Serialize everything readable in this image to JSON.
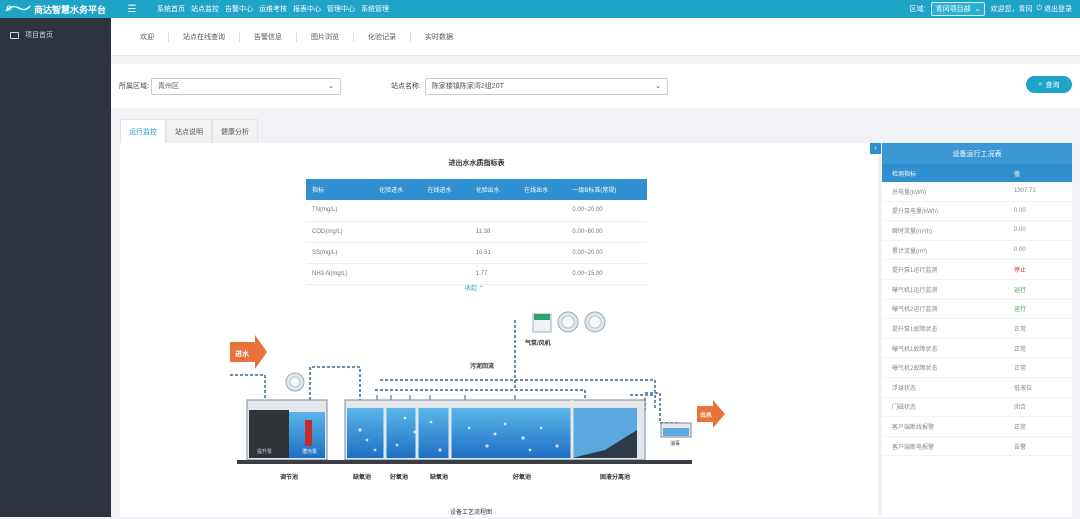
{
  "app": {
    "logo_small": "Shangda",
    "title": "商达智慧水务平台"
  },
  "nav": [
    "系统首页",
    "站点监控",
    "告警中心",
    "运维考核",
    "报表中心",
    "管理中心",
    "系统管理"
  ],
  "header": {
    "region_label": "区域:",
    "region_value": "青冈项目部",
    "welcome": "欢迎您，青冈",
    "logout": "退出登录"
  },
  "sidebar": {
    "items": [
      "项目首页"
    ]
  },
  "subtabs": [
    "欢迎",
    "站点在线查询",
    "告警信息",
    "图片浏览",
    "化验记录",
    "实时数据"
  ],
  "filter": {
    "area_label": "所属区域:",
    "area_value": "青州区",
    "station_label": "站点名称:",
    "station_value": "陈家楼镇陈家湾2组20T",
    "query": "查询"
  },
  "content_tabs": [
    "运行监控",
    "站点说明",
    "健康分析"
  ],
  "indicator_table": {
    "title": "进出水水质指标表",
    "headers": [
      "指标",
      "化验进水",
      "在线进水",
      "化验出水",
      "在线出水",
      "一级B标准(常规)"
    ],
    "rows": [
      [
        "TN(mg/L)",
        "",
        "",
        "",
        "",
        "0.00~20.00"
      ],
      [
        "COD(mg/L)",
        "",
        "",
        "11.38",
        "",
        "0.00~60.00"
      ],
      [
        "SS(mg/L)",
        "",
        "",
        "10.51",
        "",
        "0.00~20.00"
      ],
      [
        "NH3-N(mg/L)",
        "",
        "",
        "1.77",
        "",
        "0.00~15.00"
      ]
    ],
    "collapse": "收起"
  },
  "diagram": {
    "inlet": "进水",
    "outlet": "出水",
    "pump_label": "气泵/风机",
    "return_label": "污泥回流",
    "small_pump_a": "提升泵",
    "small_pump_b": "潜污泵",
    "disinfect": "消毒",
    "tanks": [
      "调节池",
      "缺氧池",
      "好氧池",
      "缺氧池",
      "好氧池",
      "固液分离池"
    ],
    "caption": "设备工艺流程图"
  },
  "right_panel": {
    "title": "设备运行工况表",
    "headers": [
      "检测指标",
      "值"
    ],
    "rows": [
      [
        "总电量(kWh)",
        "1307.71"
      ],
      [
        "提升泵电量(kWh)",
        "0.00"
      ],
      [
        "瞬时流量(m³/h)",
        "0.00"
      ],
      [
        "累计流量(m³)",
        "0.00"
      ],
      [
        "提升泵1运行监测",
        "停止"
      ],
      [
        "曝气机1运行监测",
        "运行"
      ],
      [
        "曝气机2运行监测",
        "运行"
      ],
      [
        "提升泵1故障状态",
        "正常"
      ],
      [
        "曝气机1故障状态",
        "正常"
      ],
      [
        "曝气机2故障状态",
        "正常"
      ],
      [
        "浮球状态",
        "低液位"
      ],
      [
        "门磁状态",
        "闭合"
      ],
      [
        "客户端断线报警",
        "正常"
      ],
      [
        "客户端断电报警",
        "告警"
      ]
    ],
    "status_colors": {
      "停止": "#e0342b",
      "运行": "#22a84a"
    }
  }
}
